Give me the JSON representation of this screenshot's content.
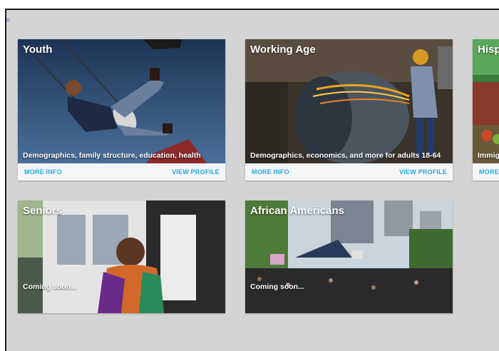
{
  "skip_link": "n",
  "cards": [
    {
      "title": "Youth",
      "description": "Demographics, family structure, education, health",
      "more_info": "MORE INFO",
      "view_profile": "VIEW PROFILE"
    },
    {
      "title": "Working Age",
      "description": "Demographics, economics, and more for adults 18-64",
      "more_info": "MORE INFO",
      "view_profile": "VIEW PROFILE"
    },
    {
      "title": "Hisp",
      "description": "Immig",
      "more_info": "MORE"
    },
    {
      "title": "Seniors",
      "description": "Coming soon..."
    },
    {
      "title": "African Americans",
      "description": "Coming soon..."
    }
  ]
}
